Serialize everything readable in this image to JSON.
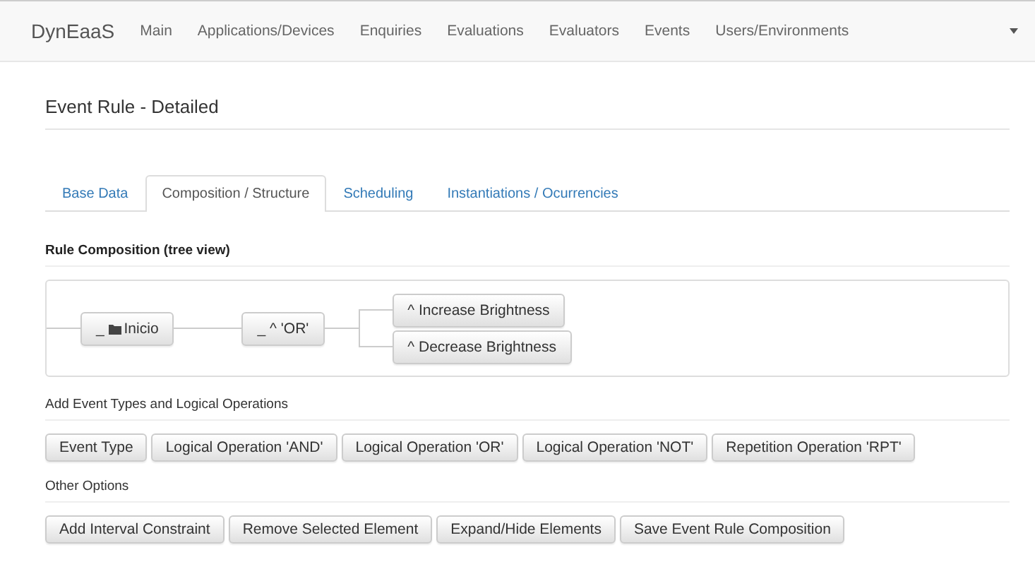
{
  "navbar": {
    "brand": "DynEaaS",
    "items": [
      {
        "label": "Main"
      },
      {
        "label": "Applications/Devices"
      },
      {
        "label": "Enquiries"
      },
      {
        "label": "Evaluations"
      },
      {
        "label": "Evaluators"
      },
      {
        "label": "Events"
      },
      {
        "label": "Users/Environments"
      }
    ]
  },
  "page_title": "Event Rule - Detailed",
  "tabs": [
    {
      "label": "Base Data",
      "selected": false
    },
    {
      "label": "Composition / Structure",
      "selected": true
    },
    {
      "label": "Scheduling",
      "selected": false
    },
    {
      "label": "Instantiations / Ocurrencies",
      "selected": false
    }
  ],
  "rule_composition": {
    "heading": "Rule Composition (tree view)",
    "tree": {
      "toggle": "_",
      "label": "Inicio",
      "children": [
        {
          "toggle": "_",
          "label": "^ 'OR'",
          "children": [
            {
              "label": "^ Increase Brightness"
            },
            {
              "label": "^ Decrease Brightness"
            }
          ]
        }
      ]
    }
  },
  "add_section": {
    "heading": "Add Event Types and Logical Operations",
    "buttons": [
      "Event Type",
      "Logical Operation 'AND'",
      "Logical Operation 'OR'",
      "Logical Operation 'NOT'",
      "Repetition Operation 'RPT'"
    ]
  },
  "other_section": {
    "heading": "Other Options",
    "buttons": [
      "Add Interval Constraint",
      "Remove Selected Element",
      "Expand/Hide Elements",
      "Save Event Rule Composition"
    ]
  }
}
